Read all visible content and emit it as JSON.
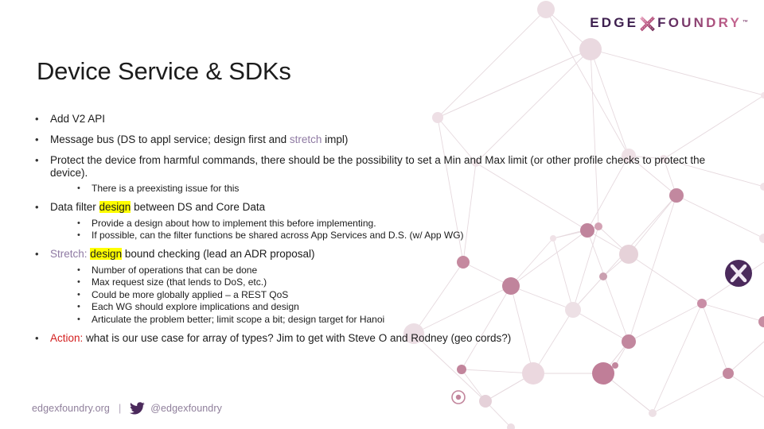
{
  "brand": {
    "logo_edge": "EDGE",
    "logo_x_icon": "x-logo-icon",
    "logo_foundry": "FOUNDRY",
    "logo_tm": "™",
    "colors": {
      "logo_dark_purple": "#3d1f4e",
      "logo_pink": "#c86a94",
      "footer_purple": "#8f7f9b",
      "stretch_purple": "#8f7aa3",
      "action_red": "#d31d1d",
      "highlight_yellow": "#ffff00",
      "node_pink": "#c08098",
      "node_light": "#ecdde3"
    }
  },
  "slide": {
    "title": "Device Service & SDKs"
  },
  "bullets": [
    {
      "level": 1,
      "marker": "•",
      "parts": [
        {
          "text": "Add V2 API"
        }
      ]
    },
    {
      "level": 1,
      "marker": "•",
      "parts": [
        {
          "text": "Message bus (DS to appl service; design first and "
        },
        {
          "text": "stretch",
          "style": "stretch"
        },
        {
          "text": " impl)"
        }
      ]
    },
    {
      "level": 1,
      "marker": "•",
      "parts": [
        {
          "text": "Protect the device from harmful commands, there should be the possibility to set a Min and Max limit (or other profile checks to protect the device)."
        }
      ]
    },
    {
      "level": 2,
      "marker": "•",
      "parts": [
        {
          "text": "There is a preexisting issue for this"
        }
      ]
    },
    {
      "level": 1,
      "marker": "•",
      "parts": [
        {
          "text": "Data filter "
        },
        {
          "text": "design",
          "style": "highlight"
        },
        {
          "text": " between DS and Core Data"
        }
      ]
    },
    {
      "level": 2,
      "marker": "•",
      "parts": [
        {
          "text": "Provide a design about how to implement this before implementing."
        }
      ]
    },
    {
      "level": 2,
      "marker": "•",
      "parts": [
        {
          "text": "If possible, can the filter functions be shared across App Services and D.S. (w/ App WG)"
        }
      ]
    },
    {
      "level": 1,
      "marker": "•",
      "parts": [
        {
          "text": "Stretch:",
          "style": "stretch"
        },
        {
          "text": "  "
        },
        {
          "text": "design",
          "style": "highlight"
        },
        {
          "text": " bound checking (lead an ADR proposal)"
        }
      ]
    },
    {
      "level": 2,
      "marker": "•",
      "parts": [
        {
          "text": "Number of operations that can be done"
        }
      ]
    },
    {
      "level": 2,
      "marker": "•",
      "parts": [
        {
          "text": "Max request size (that lends to DoS, etc.)"
        }
      ]
    },
    {
      "level": 2,
      "marker": "•",
      "parts": [
        {
          "text": "Could be more globally applied – a REST QoS"
        }
      ]
    },
    {
      "level": 2,
      "marker": "•",
      "parts": [
        {
          "text": "Each WG should explore implications and design"
        }
      ]
    },
    {
      "level": 2,
      "marker": "•",
      "parts": [
        {
          "text": "Articulate the problem better; limit scope a bit; design target for Hanoi"
        }
      ]
    },
    {
      "level": 1,
      "marker": "•",
      "parts": [
        {
          "text": "Action:",
          "style": "action"
        },
        {
          "text": "  what is our use case for array of types?  Jim to get with Steve O and Rodney (geo cords?)"
        }
      ]
    }
  ],
  "footer": {
    "site": "edgexfoundry.org",
    "separator": "|",
    "twitter_icon": "twitter-bird-icon",
    "handle": "@edgexfoundry"
  }
}
